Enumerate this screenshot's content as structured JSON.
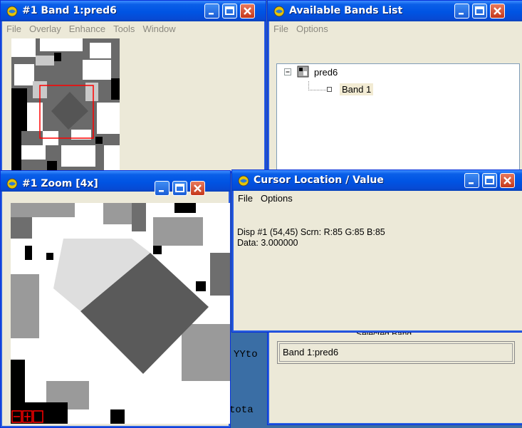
{
  "image_window": {
    "title": "#1 Band 1:pred6",
    "menu": [
      "File",
      "Overlay",
      "Enhance",
      "Tools",
      "Window"
    ]
  },
  "bands_window": {
    "title": "Available Bands List",
    "menu": [
      "File",
      "Options"
    ],
    "tree": {
      "file": "pred6",
      "band": "Band 1"
    },
    "selected_band_label": "Selected Band",
    "selected_band_value": "Band 1:pred6"
  },
  "zoom_window": {
    "title": "#1 Zoom [4x]"
  },
  "cursor_window": {
    "title": "Cursor Location / Value",
    "menu": [
      "File",
      "Options"
    ],
    "line1": "Disp #1 (54,45) Scrn: R:85 G:85 B:85",
    "line2": "Data: 3.000000"
  },
  "background_text": [
    "YYto",
    "tota"
  ],
  "colors": {
    "titlebar": "#0054e3",
    "window_face": "#ece9d8",
    "close_button": "#c5371a",
    "roi_box": "#ff0000"
  },
  "icons": [
    "envi-globe-icon",
    "minimize-icon",
    "maximize-icon",
    "close-icon",
    "tree-collapse-icon",
    "band-image-icon"
  ]
}
